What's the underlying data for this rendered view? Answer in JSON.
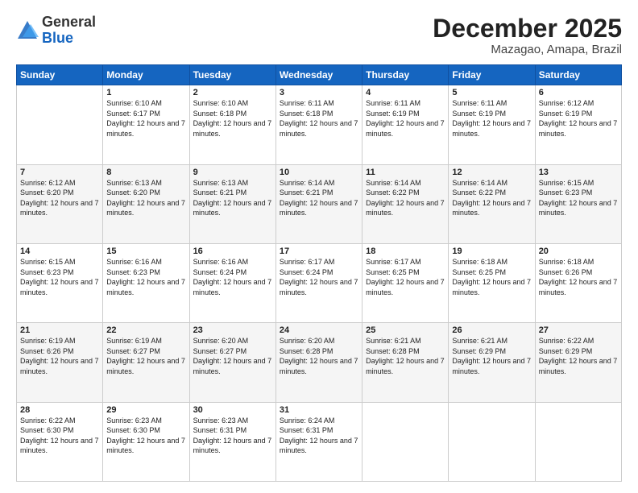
{
  "header": {
    "logo_general": "General",
    "logo_blue": "Blue",
    "month": "December 2025",
    "location": "Mazagao, Amapa, Brazil"
  },
  "weekdays": [
    "Sunday",
    "Monday",
    "Tuesday",
    "Wednesday",
    "Thursday",
    "Friday",
    "Saturday"
  ],
  "weeks": [
    [
      {
        "day": "",
        "sunrise": "",
        "sunset": "",
        "daylight": ""
      },
      {
        "day": "1",
        "sunrise": "Sunrise: 6:10 AM",
        "sunset": "Sunset: 6:17 PM",
        "daylight": "Daylight: 12 hours and 7 minutes."
      },
      {
        "day": "2",
        "sunrise": "Sunrise: 6:10 AM",
        "sunset": "Sunset: 6:18 PM",
        "daylight": "Daylight: 12 hours and 7 minutes."
      },
      {
        "day": "3",
        "sunrise": "Sunrise: 6:11 AM",
        "sunset": "Sunset: 6:18 PM",
        "daylight": "Daylight: 12 hours and 7 minutes."
      },
      {
        "day": "4",
        "sunrise": "Sunrise: 6:11 AM",
        "sunset": "Sunset: 6:19 PM",
        "daylight": "Daylight: 12 hours and 7 minutes."
      },
      {
        "day": "5",
        "sunrise": "Sunrise: 6:11 AM",
        "sunset": "Sunset: 6:19 PM",
        "daylight": "Daylight: 12 hours and 7 minutes."
      },
      {
        "day": "6",
        "sunrise": "Sunrise: 6:12 AM",
        "sunset": "Sunset: 6:19 PM",
        "daylight": "Daylight: 12 hours and 7 minutes."
      }
    ],
    [
      {
        "day": "7",
        "sunrise": "Sunrise: 6:12 AM",
        "sunset": "Sunset: 6:20 PM",
        "daylight": "Daylight: 12 hours and 7 minutes."
      },
      {
        "day": "8",
        "sunrise": "Sunrise: 6:13 AM",
        "sunset": "Sunset: 6:20 PM",
        "daylight": "Daylight: 12 hours and 7 minutes."
      },
      {
        "day": "9",
        "sunrise": "Sunrise: 6:13 AM",
        "sunset": "Sunset: 6:21 PM",
        "daylight": "Daylight: 12 hours and 7 minutes."
      },
      {
        "day": "10",
        "sunrise": "Sunrise: 6:14 AM",
        "sunset": "Sunset: 6:21 PM",
        "daylight": "Daylight: 12 hours and 7 minutes."
      },
      {
        "day": "11",
        "sunrise": "Sunrise: 6:14 AM",
        "sunset": "Sunset: 6:22 PM",
        "daylight": "Daylight: 12 hours and 7 minutes."
      },
      {
        "day": "12",
        "sunrise": "Sunrise: 6:14 AM",
        "sunset": "Sunset: 6:22 PM",
        "daylight": "Daylight: 12 hours and 7 minutes."
      },
      {
        "day": "13",
        "sunrise": "Sunrise: 6:15 AM",
        "sunset": "Sunset: 6:23 PM",
        "daylight": "Daylight: 12 hours and 7 minutes."
      }
    ],
    [
      {
        "day": "14",
        "sunrise": "Sunrise: 6:15 AM",
        "sunset": "Sunset: 6:23 PM",
        "daylight": "Daylight: 12 hours and 7 minutes."
      },
      {
        "day": "15",
        "sunrise": "Sunrise: 6:16 AM",
        "sunset": "Sunset: 6:23 PM",
        "daylight": "Daylight: 12 hours and 7 minutes."
      },
      {
        "day": "16",
        "sunrise": "Sunrise: 6:16 AM",
        "sunset": "Sunset: 6:24 PM",
        "daylight": "Daylight: 12 hours and 7 minutes."
      },
      {
        "day": "17",
        "sunrise": "Sunrise: 6:17 AM",
        "sunset": "Sunset: 6:24 PM",
        "daylight": "Daylight: 12 hours and 7 minutes."
      },
      {
        "day": "18",
        "sunrise": "Sunrise: 6:17 AM",
        "sunset": "Sunset: 6:25 PM",
        "daylight": "Daylight: 12 hours and 7 minutes."
      },
      {
        "day": "19",
        "sunrise": "Sunrise: 6:18 AM",
        "sunset": "Sunset: 6:25 PM",
        "daylight": "Daylight: 12 hours and 7 minutes."
      },
      {
        "day": "20",
        "sunrise": "Sunrise: 6:18 AM",
        "sunset": "Sunset: 6:26 PM",
        "daylight": "Daylight: 12 hours and 7 minutes."
      }
    ],
    [
      {
        "day": "21",
        "sunrise": "Sunrise: 6:19 AM",
        "sunset": "Sunset: 6:26 PM",
        "daylight": "Daylight: 12 hours and 7 minutes."
      },
      {
        "day": "22",
        "sunrise": "Sunrise: 6:19 AM",
        "sunset": "Sunset: 6:27 PM",
        "daylight": "Daylight: 12 hours and 7 minutes."
      },
      {
        "day": "23",
        "sunrise": "Sunrise: 6:20 AM",
        "sunset": "Sunset: 6:27 PM",
        "daylight": "Daylight: 12 hours and 7 minutes."
      },
      {
        "day": "24",
        "sunrise": "Sunrise: 6:20 AM",
        "sunset": "Sunset: 6:28 PM",
        "daylight": "Daylight: 12 hours and 7 minutes."
      },
      {
        "day": "25",
        "sunrise": "Sunrise: 6:21 AM",
        "sunset": "Sunset: 6:28 PM",
        "daylight": "Daylight: 12 hours and 7 minutes."
      },
      {
        "day": "26",
        "sunrise": "Sunrise: 6:21 AM",
        "sunset": "Sunset: 6:29 PM",
        "daylight": "Daylight: 12 hours and 7 minutes."
      },
      {
        "day": "27",
        "sunrise": "Sunrise: 6:22 AM",
        "sunset": "Sunset: 6:29 PM",
        "daylight": "Daylight: 12 hours and 7 minutes."
      }
    ],
    [
      {
        "day": "28",
        "sunrise": "Sunrise: 6:22 AM",
        "sunset": "Sunset: 6:30 PM",
        "daylight": "Daylight: 12 hours and 7 minutes."
      },
      {
        "day": "29",
        "sunrise": "Sunrise: 6:23 AM",
        "sunset": "Sunset: 6:30 PM",
        "daylight": "Daylight: 12 hours and 7 minutes."
      },
      {
        "day": "30",
        "sunrise": "Sunrise: 6:23 AM",
        "sunset": "Sunset: 6:31 PM",
        "daylight": "Daylight: 12 hours and 7 minutes."
      },
      {
        "day": "31",
        "sunrise": "Sunrise: 6:24 AM",
        "sunset": "Sunset: 6:31 PM",
        "daylight": "Daylight: 12 hours and 7 minutes."
      },
      {
        "day": "",
        "sunrise": "",
        "sunset": "",
        "daylight": ""
      },
      {
        "day": "",
        "sunrise": "",
        "sunset": "",
        "daylight": ""
      },
      {
        "day": "",
        "sunrise": "",
        "sunset": "",
        "daylight": ""
      }
    ]
  ]
}
